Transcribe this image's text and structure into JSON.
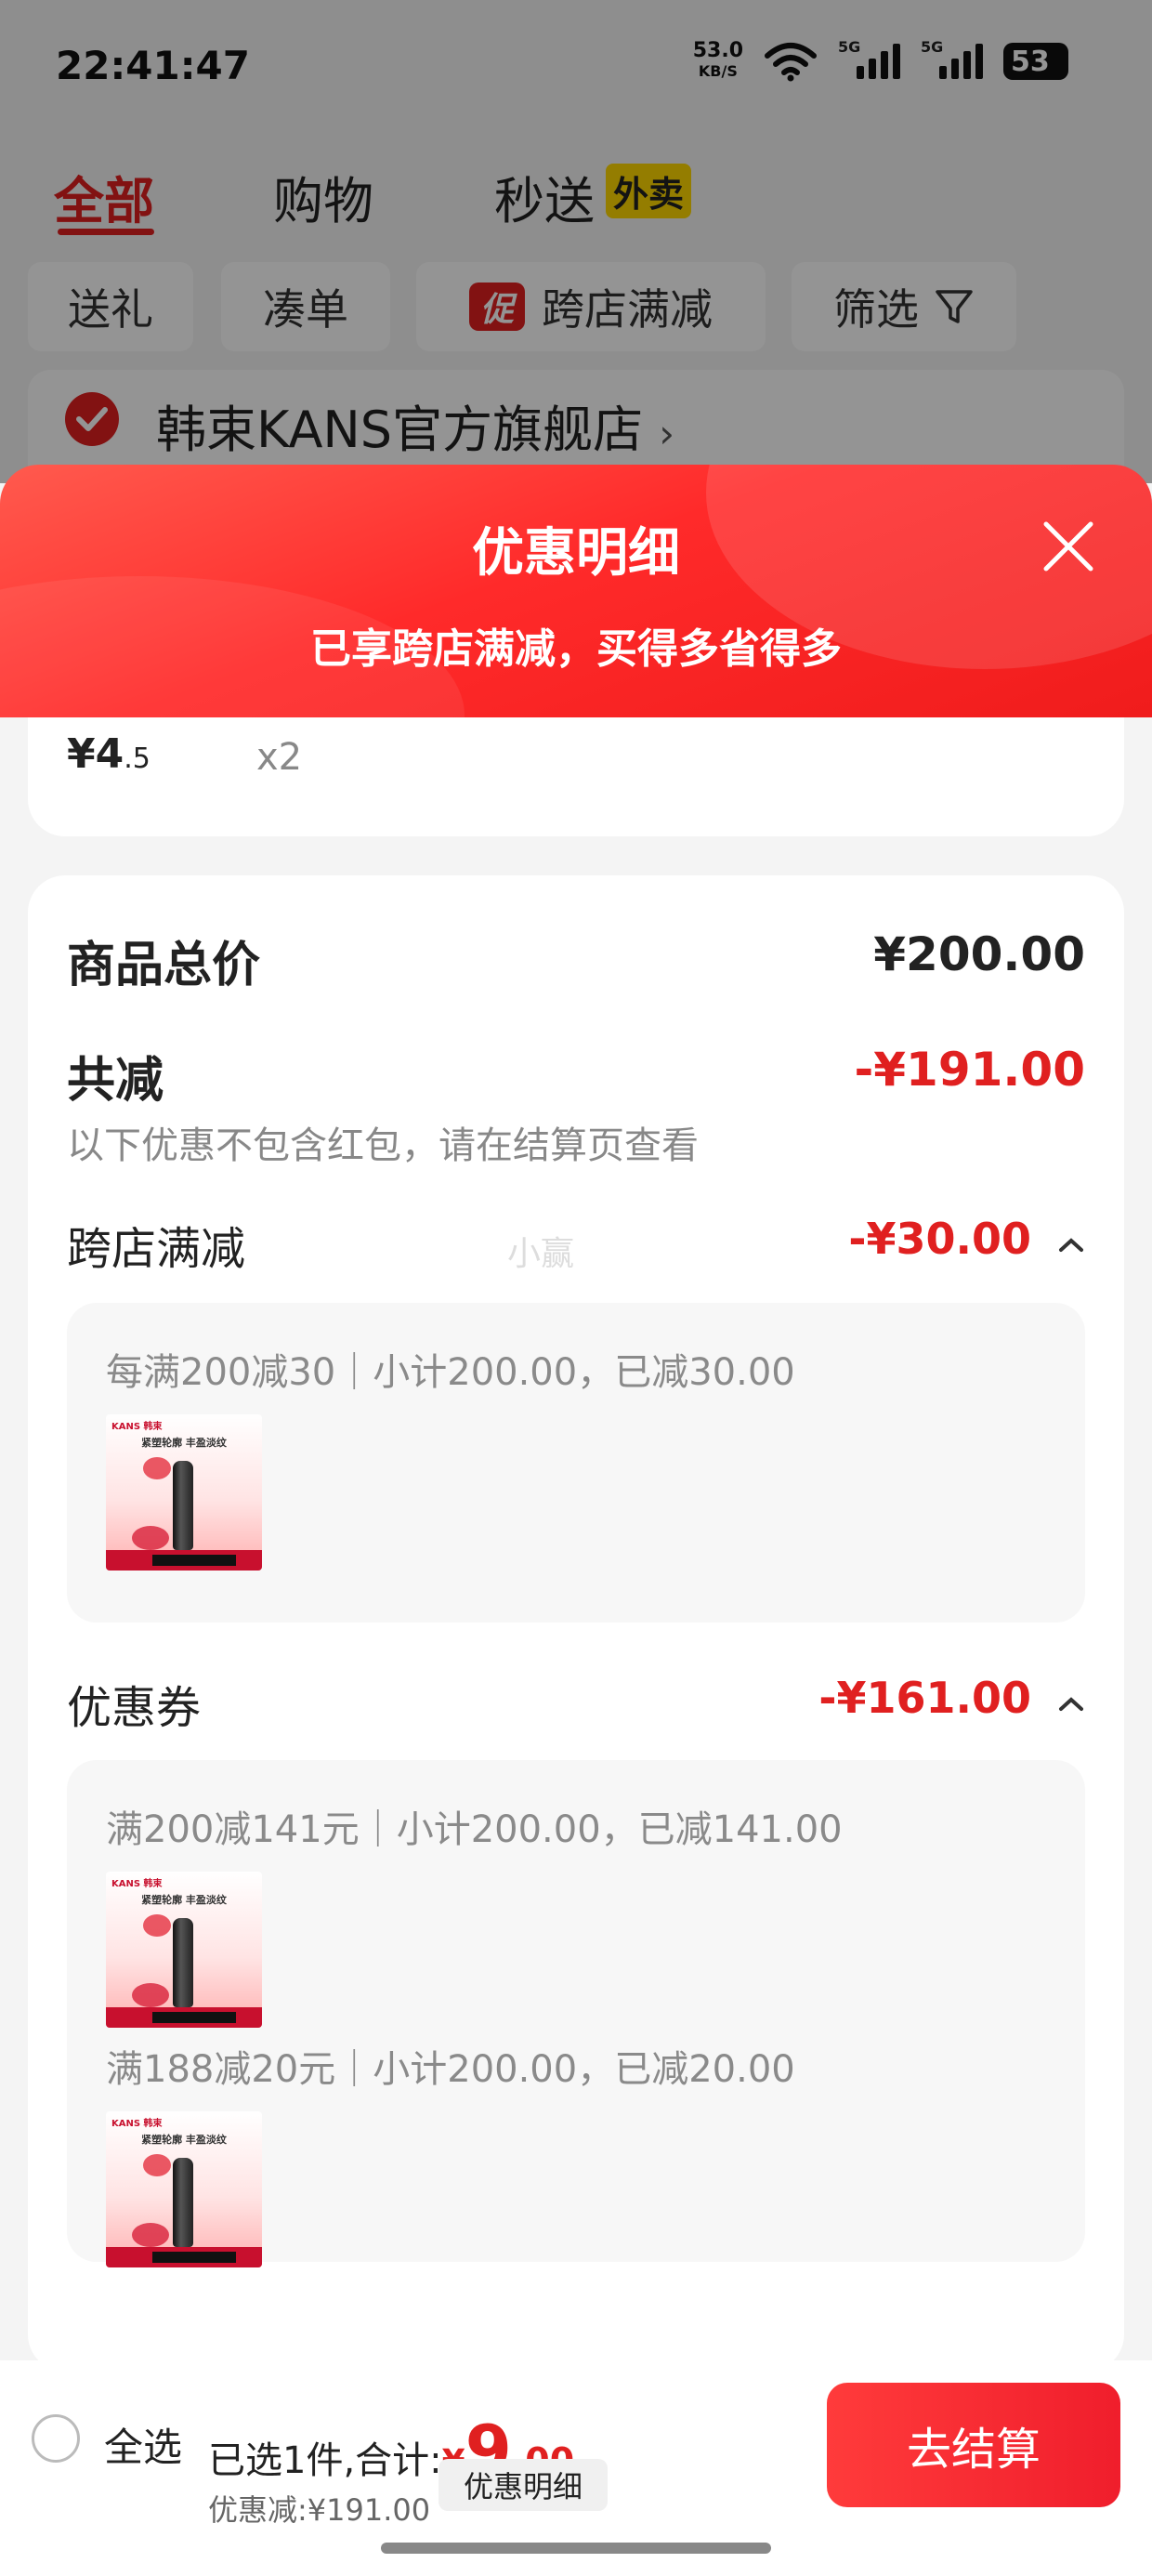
{
  "status_bar": {
    "time": "22:41:47",
    "net_speed": "53.0",
    "net_unit": "KB/S",
    "signal_label_1": "5G",
    "signal_label_2": "5G",
    "battery": "53"
  },
  "tabs": [
    {
      "label": "全部",
      "active": true
    },
    {
      "label": "购物",
      "active": false
    },
    {
      "label": "秒送",
      "active": false
    }
  ],
  "waimai_badge": "外卖",
  "filters": {
    "gift": "送礼",
    "bundle": "凑单",
    "promo_tag": "促",
    "cross_store": "跨店满减",
    "filter": "筛选"
  },
  "store": {
    "name": "韩束KANS官方旗舰店",
    "arrow": "›"
  },
  "sheet": {
    "title": "优惠明细",
    "subtitle": "已享跨店满减，买得多省得多"
  },
  "item": {
    "price_int": "¥4",
    "price_dec": ".5",
    "qty": "x2"
  },
  "summary": {
    "total_label": "商品总价",
    "total_value": "¥200.00",
    "reduce_label": "共减",
    "reduce_value": "-¥191.00",
    "note": "以下优惠不包含红包，请在结算页查看",
    "cross_label": "跨店满减",
    "cross_value": "-¥30.00",
    "cross_detail": "每满200减30｜小计200.00，已减30.00",
    "coupon_label": "优惠券",
    "coupon_value": "-¥161.00",
    "coupon_detail_1": "满200减141元｜小计200.00，已减141.00",
    "coupon_detail_2": "满188减20元｜小计200.00，已减20.00",
    "chevron": "^",
    "watermark": "小赢"
  },
  "product_thumb": {
    "brand": "KANS 韩束",
    "headline": "紧塑轮廓 丰盈淡纹"
  },
  "bottom": {
    "select_all": "全选",
    "selected_prefix": "已选1件,合计:",
    "yen": "¥",
    "total_int": "9",
    "total_dec": ".00",
    "discount": "优惠减:¥191.00",
    "detail_pill": "优惠明细",
    "checkout": "去结算"
  },
  "colors": {
    "accent": "#e02020",
    "badge": "#ffd700"
  }
}
